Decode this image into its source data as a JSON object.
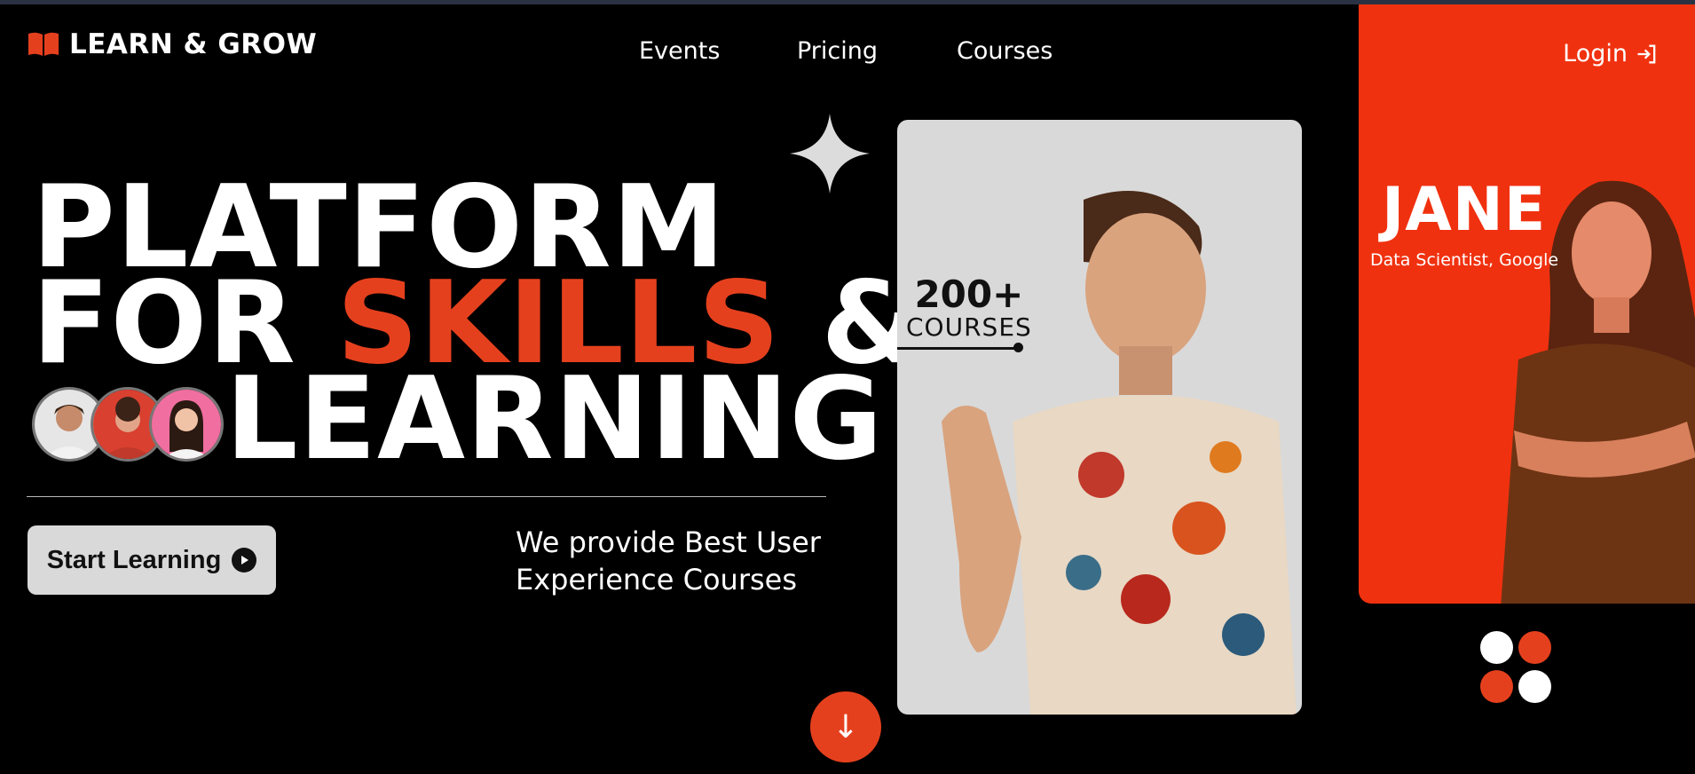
{
  "brand": {
    "name": "LEARN & GROW",
    "icon": "open-book-icon"
  },
  "nav": {
    "items": [
      {
        "label": "Events"
      },
      {
        "label": "Pricing"
      },
      {
        "label": "Courses"
      }
    ]
  },
  "login": {
    "label": "Login",
    "icon": "login-arrow-icon"
  },
  "hero": {
    "line1": "PLATFORM",
    "line2_a": "FOR ",
    "line2_accent": "SKILLS",
    "line2_b": " &",
    "line3": "LEARNING",
    "cta_label": "Start Learning",
    "cta_icon": "play-circle-icon",
    "tagline": "We provide Best User Experience Courses"
  },
  "stats": {
    "number": "200+",
    "label": "COURSES"
  },
  "profile": {
    "name": "JANE",
    "role": "Data Scientist, Google"
  },
  "colors": {
    "accent": "#e5401e",
    "panel": "#f0310f",
    "card": "#d9d9d9",
    "background": "#000000"
  },
  "dots": [
    "#ffffff",
    "#e5401e",
    "#e5401e",
    "#ffffff"
  ],
  "scroll": {
    "icon": "arrow-down-icon",
    "glyph": "↓"
  }
}
